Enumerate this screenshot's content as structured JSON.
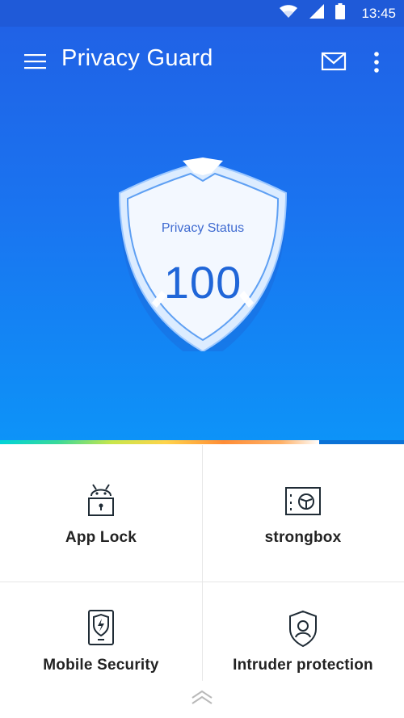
{
  "status_bar": {
    "time": "13:45",
    "icons": [
      "wifi-icon",
      "cellular-signal-icon",
      "battery-icon"
    ]
  },
  "app_bar": {
    "title": "Privacy Guard",
    "menu_icon": "hamburger-menu-icon",
    "mail_icon": "mail-icon",
    "more_icon": "more-vertical-icon"
  },
  "privacy_status": {
    "label": "Privacy Status",
    "score": "100",
    "progress": 0.79
  },
  "features": [
    {
      "label": "App Lock",
      "icon": "android-lock-icon"
    },
    {
      "label": "strongbox",
      "icon": "safe-icon"
    },
    {
      "label": "Mobile Security",
      "icon": "phone-shield-icon"
    },
    {
      "label": "Intruder protection",
      "icon": "shield-person-icon"
    }
  ],
  "expand_icon": "chevron-up-double-icon",
  "colors": {
    "header_gradient_top": "#2062e6",
    "header_gradient_bottom": "#0d93f8",
    "accent": "#2066d8",
    "text_dark": "#222222",
    "divider": "#e7e7e7"
  }
}
